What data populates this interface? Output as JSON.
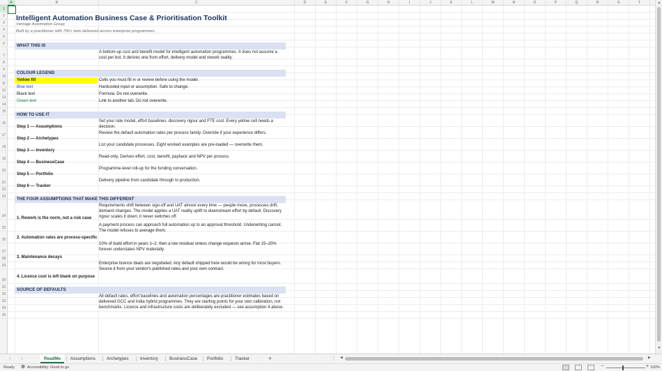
{
  "columns": [
    "A",
    "B",
    "C",
    "D",
    "E",
    "F",
    "G",
    "H",
    "I",
    "J",
    "K",
    "L",
    "M",
    "N",
    "O",
    "P",
    "Q",
    "R",
    "S",
    "T"
  ],
  "rows": [
    "1",
    "2",
    "3",
    "4",
    "5",
    "6",
    "7",
    "8",
    "9",
    "10",
    "11",
    "12",
    "13",
    "14",
    "15",
    "16",
    "17",
    "18",
    "19",
    "20",
    "21",
    "22",
    "23",
    "24",
    "25",
    "26",
    "27",
    "28",
    "29",
    "30",
    "31",
    "32",
    "33",
    "34",
    "35"
  ],
  "sheet": {
    "title": "Intelligent Automation Business Case & Prioritisation Toolkit",
    "subtitle1": "Vantage Automation Group",
    "subtitle2": "Built by a practitioner with 700+ bots delivered across enterprise programmes.",
    "what_header": "WHAT THIS IS",
    "what_text": "A bottom-up cost and benefit model for intelligent automation programmes. It does not assume a cost per bot. It derives one from effort, delivery model and rework reality.",
    "legend_header": "COLOUR LEGEND",
    "legend": [
      {
        "label": "Yellow fill",
        "desc": "Cells you must fill in or review before using the model."
      },
      {
        "label": "Blue text",
        "desc": "Hardcoded input or assumption. Safe to change."
      },
      {
        "label": "Black text",
        "desc": "Formula. Do not overwrite."
      },
      {
        "label": "Green text",
        "desc": "Link to another tab. Do not overwrite."
      }
    ],
    "howto_header": "HOW TO USE IT",
    "steps": [
      {
        "label": "Step 1 — Assumptions",
        "desc": "Set your rate model, effort baselines, discovery rigour and FTE cost. Every yellow cell needs a decision."
      },
      {
        "label": "Step 2 — Archetypes",
        "desc": "Review the default automation rates per process family. Override if your experience differs."
      },
      {
        "label": "Step 3 — Inventory",
        "desc": "List your candidate processes. Eight worked examples are pre-loaded — overwrite them."
      },
      {
        "label": "Step 4 — BusinessCase",
        "desc": "Read-only. Derives effort, cost, benefit, payback and NPV per process."
      },
      {
        "label": "Step 5 — Portfolio",
        "desc": "Programme-level roll-up for the funding conversation."
      },
      {
        "label": "Step 6 — Tracker",
        "desc": "Delivery pipeline from candidate through to production."
      }
    ],
    "four_header": "THE FOUR ASSUMPTIONS THAT MAKE THIS DIFFERENT",
    "assumptions": [
      {
        "label": "1. Rework is the norm, not a risk case",
        "desc": "Requirements shift between sign-off and UAT almost every time — people move, processes drift, demand changes. The model applies a UAT reality uplift to downstream effort by default. Discovery rigour scales it down; it never switches off."
      },
      {
        "label": "2. Automation rates are process-specific",
        "desc": "A payment process can approach full automation up to an approval threshold. Underwriting cannot. The model refuses to average them."
      },
      {
        "label": "3. Maintenance decays",
        "desc": "10% of build effort in years 1–2, then a low residual unless change requests arrive. Flat 15–20% forever understates NPV materially."
      },
      {
        "label": "4. Licence cost is left blank on purpose",
        "desc": "Enterprise licence deals are negotiated. Any default shipped here would be wrong for most buyers. Source it from your vendor's published rates and your own contract."
      }
    ],
    "source_header": "SOURCE OF DEFAULTS",
    "source_text": "All default rates, effort baselines and automation percentages are practitioner estimates based on delivered GCC and India hybrid programmes. They are starting points for your own calibration, not benchmarks. Licence and infrastructure costs are deliberately excluded — see assumption 4 above."
  },
  "tabs": [
    {
      "label": "ReadMe",
      "active": true
    },
    {
      "label": "Assumptions",
      "active": false
    },
    {
      "label": "Archetypes",
      "active": false
    },
    {
      "label": "Inventory",
      "active": false
    },
    {
      "label": "BusinessCase",
      "active": false
    },
    {
      "label": "Portfolio",
      "active": false
    },
    {
      "label": "Tracker",
      "active": false
    }
  ],
  "status": {
    "ready": "Ready",
    "accessibility": "Accessibility: Good to go",
    "zoom": "100%"
  },
  "colors": {
    "excel_green": "#217346",
    "band": "#d9e1f2",
    "yellow": "#ffff00",
    "blue_text": "#1f4fd6",
    "green_text": "#217346",
    "title": "#1f3864"
  },
  "icons": {
    "accessibility": "accessibility-icon",
    "add_sheet": "plus-icon"
  }
}
